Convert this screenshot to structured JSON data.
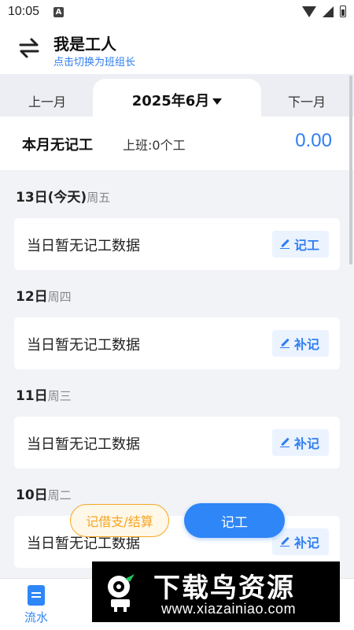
{
  "status_bar": {
    "time": "10:05",
    "notification_icon": "a-icon",
    "wifi_icon": "wifi-icon",
    "signal_icon": "signal-icon",
    "battery_icon": "battery-icon"
  },
  "header": {
    "title": "我是工人",
    "subtitle": "点击切换为班组长",
    "switch_icon": "swap-icon"
  },
  "month_bar": {
    "prev_label": "上一月",
    "current_label": "2025年6月",
    "next_label": "下一月"
  },
  "summary": {
    "title": "本月无记工",
    "shift": "上班:0个工",
    "amount": "0.00"
  },
  "days": [
    {
      "date": "13日(今天)",
      "weekday": "周五",
      "text": "当日暂无记工数据",
      "button": "记工"
    },
    {
      "date": "12日",
      "weekday": "周四",
      "text": "当日暂无记工数据",
      "button": "补记"
    },
    {
      "date": "11日",
      "weekday": "周三",
      "text": "当日暂无记工数据",
      "button": "补记"
    },
    {
      "date": "10日",
      "weekday": "周二",
      "text": "当日暂无记工数据",
      "button": "补记"
    }
  ],
  "actions": {
    "borrow_label": "记借支/结算",
    "record_label": "记工"
  },
  "bottom_nav": {
    "flow_label": "流水",
    "flow_icon": "document-icon"
  },
  "watermark": {
    "title": "下载鸟资源",
    "url": "www.xiazainiao.com"
  },
  "colors": {
    "accent": "#2f7ef0",
    "orange": "#f5a623",
    "background": "#f2f3f7"
  }
}
